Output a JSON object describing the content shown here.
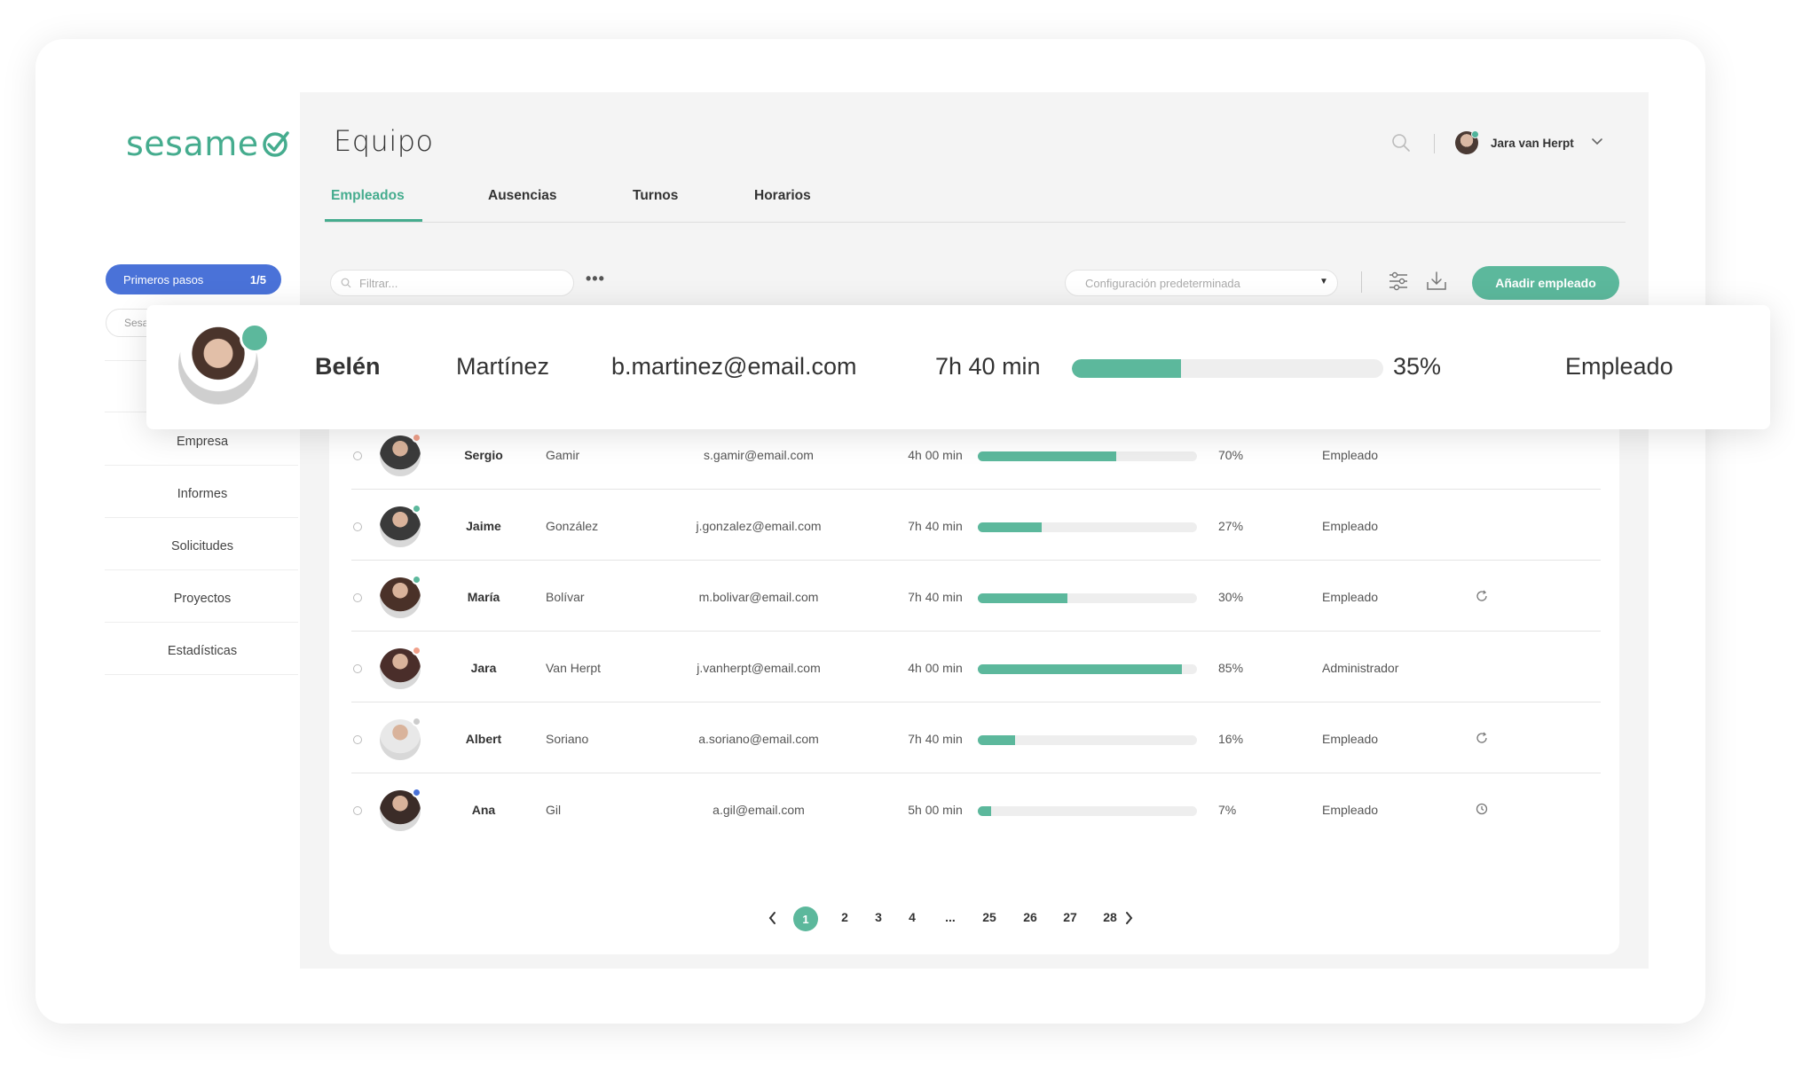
{
  "brand": {
    "name": "sesame"
  },
  "sidebar": {
    "steps_label": "Primeros pasos",
    "steps_count": "1/5",
    "search_partial": "Sesa",
    "items": [
      "Empresa",
      "Informes",
      "Solicitudes",
      "Proyectos",
      "Estadísticas"
    ]
  },
  "header": {
    "title": "Equipo",
    "user_name": "Jara van Herpt",
    "icons": [
      "search-icon",
      "chevron-down-icon"
    ]
  },
  "tabs": [
    "Empleados",
    "Ausencias",
    "Turnos",
    "Horarios"
  ],
  "toolbar": {
    "filter_placeholder": "Filtrar...",
    "more_label": "•••",
    "config_value": "Configuración predeterminada",
    "add_button": "Añadir empleado",
    "icons": [
      "sliders-icon",
      "download-icon"
    ]
  },
  "highlight": {
    "first": "Belén",
    "last": "Martínez",
    "email": "b.martinez@email.com",
    "hours": "7h 40 min",
    "progress": 0.35,
    "pct": "35%",
    "role": "Empleado",
    "status_color": "#5cb89c"
  },
  "employees": [
    {
      "first": "Sergio",
      "last": "Gamir",
      "email": "s.gamir@email.com",
      "hours": "4h 00 min",
      "progress": 0.63,
      "pct": "70%",
      "role": "Empleado",
      "status_color": "#f0a08a",
      "icon": ""
    },
    {
      "first": "Jaime",
      "last": "González",
      "email": "j.gonzalez@email.com",
      "hours": "7h 40 min",
      "progress": 0.29,
      "pct": "27%",
      "role": "Empleado",
      "status_color": "#5cb89c",
      "icon": ""
    },
    {
      "first": "María",
      "last": "Bolívar",
      "email": "m.bolivar@email.com",
      "hours": "7h 40 min",
      "progress": 0.41,
      "pct": "30%",
      "role": "Empleado",
      "status_color": "#5cb89c",
      "icon": "refresh-icon"
    },
    {
      "first": "Jara",
      "last": "Van Herpt",
      "email": "j.vanherpt@email.com",
      "hours": "4h 00 min",
      "progress": 0.93,
      "pct": "85%",
      "role": "Administrador",
      "status_color": "#f0a08a",
      "icon": ""
    },
    {
      "first": "Albert",
      "last": "Soriano",
      "email": "a.soriano@email.com",
      "hours": "7h 40 min",
      "progress": 0.17,
      "pct": "16%",
      "role": "Empleado",
      "status_color": "#cccccc",
      "icon": "refresh-icon"
    },
    {
      "first": "Ana",
      "last": "Gil",
      "email": "a.gil@email.com",
      "hours": "5h 00 min",
      "progress": 0.06,
      "pct": "7%",
      "role": "Empleado",
      "status_color": "#4a72d8",
      "icon": "clock-icon"
    }
  ],
  "pagination": {
    "current": "1",
    "pages": [
      "2",
      "3",
      "4",
      "...",
      "25",
      "26",
      "27",
      "28"
    ]
  },
  "colors": {
    "accent": "#5cb89c",
    "primary_blue": "#4a72d8",
    "brand_green": "#45ac8e"
  }
}
